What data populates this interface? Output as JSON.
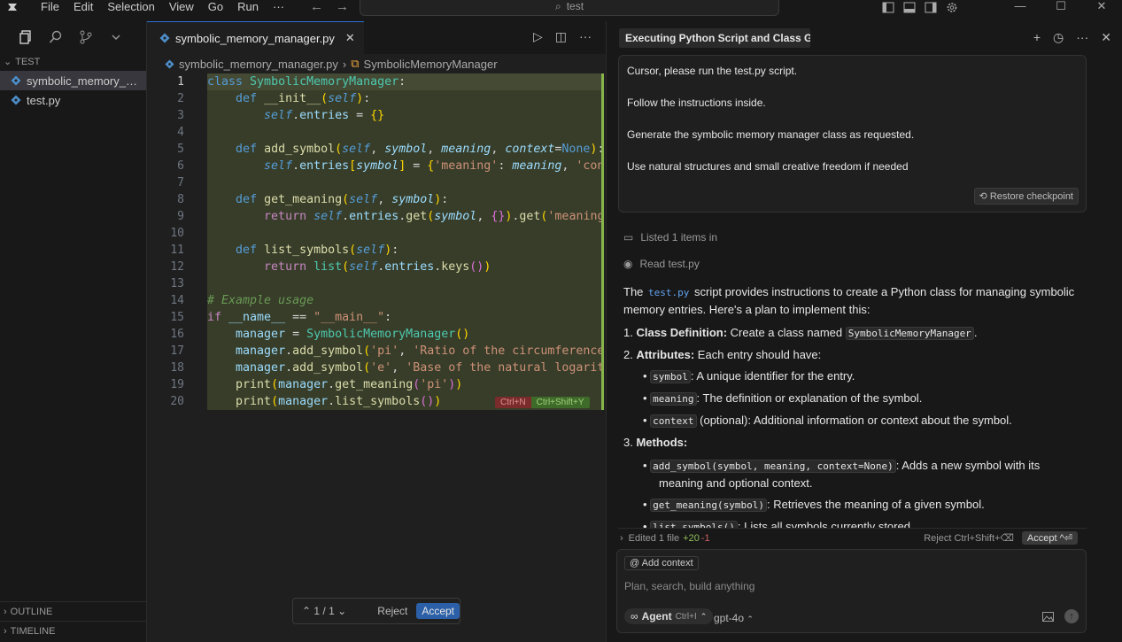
{
  "menu": [
    "File",
    "Edit",
    "Selection",
    "View",
    "Go",
    "Run",
    "···"
  ],
  "search": {
    "text": "test"
  },
  "explorer": {
    "section": "TEST",
    "files": [
      "symbolic_memory_manager.py",
      "test.py"
    ],
    "outline": "OUTLINE",
    "timeline": "TIMELINE"
  },
  "editor": {
    "tab": "symbolic_memory_manager.py",
    "breadcrumb": {
      "file": "symbolic_memory_manager.py",
      "symbol": "SymbolicMemoryManager"
    },
    "line_numbers": [
      "1",
      "2",
      "3",
      "4",
      "5",
      "6",
      "7",
      "8",
      "9",
      "10",
      "11",
      "12",
      "13",
      "14",
      "15",
      "16",
      "17",
      "18",
      "19",
      "20"
    ],
    "diff_reject": "Ctrl+N",
    "diff_accept": "Ctrl+Shift+Y",
    "review": {
      "count": "1 / 1",
      "reject": "Reject",
      "accept": "Accept"
    }
  },
  "chat": {
    "title": "Executing Python Script and Class Ger",
    "user_message": [
      "Cursor, please run the test.py script.",
      "Follow the instructions inside.",
      "Generate the symbolic memory manager class as requested.",
      "Use natural structures and small creative freedom if needed"
    ],
    "restore": "Restore checkpoint",
    "tool1": "Listed 1 items in",
    "tool2": "Read test.py",
    "resp_intro_a": "The ",
    "resp_intro_code": "test.py",
    "resp_intro_b": " script provides instructions to create a Python class for managing symbolic memory entries. Here's a plan to implement this:",
    "item1_bold": "Class Definition:",
    "item1_text": " Create a class named ",
    "item1_code": "SymbolicMemoryManager",
    "item1_end": ".",
    "item2_bold": "Attributes:",
    "item2_text": " Each entry should have:",
    "attr": [
      {
        "code": "symbol",
        "text": ": A unique identifier for the entry."
      },
      {
        "code": "meaning",
        "text": ": The definition or explanation of the symbol."
      },
      {
        "code": "context",
        "text": " (optional): Additional information or context about the symbol."
      }
    ],
    "item3_bold": "Methods:",
    "methods": [
      {
        "code": "add_symbol(symbol, meaning, context=None)",
        "text": ": Adds a new symbol with its meaning and optional context."
      },
      {
        "code": "get_meaning(symbol)",
        "text": ": Retrieves the meaning of a given symbol."
      },
      {
        "code": "list_symbols()",
        "text": ": Lists all symbols currently stored."
      }
    ],
    "edited": "Edited 1 file",
    "plus": "+20",
    "minus": "-1",
    "reject": "Reject Ctrl+Shift+⌫",
    "accept": "Accept ^⏎",
    "add_context": "Add context",
    "placeholder": "Plan, search, build anything",
    "agent": "Agent",
    "agent_shortcut": "Ctrl+I",
    "model": "gpt-4o"
  }
}
